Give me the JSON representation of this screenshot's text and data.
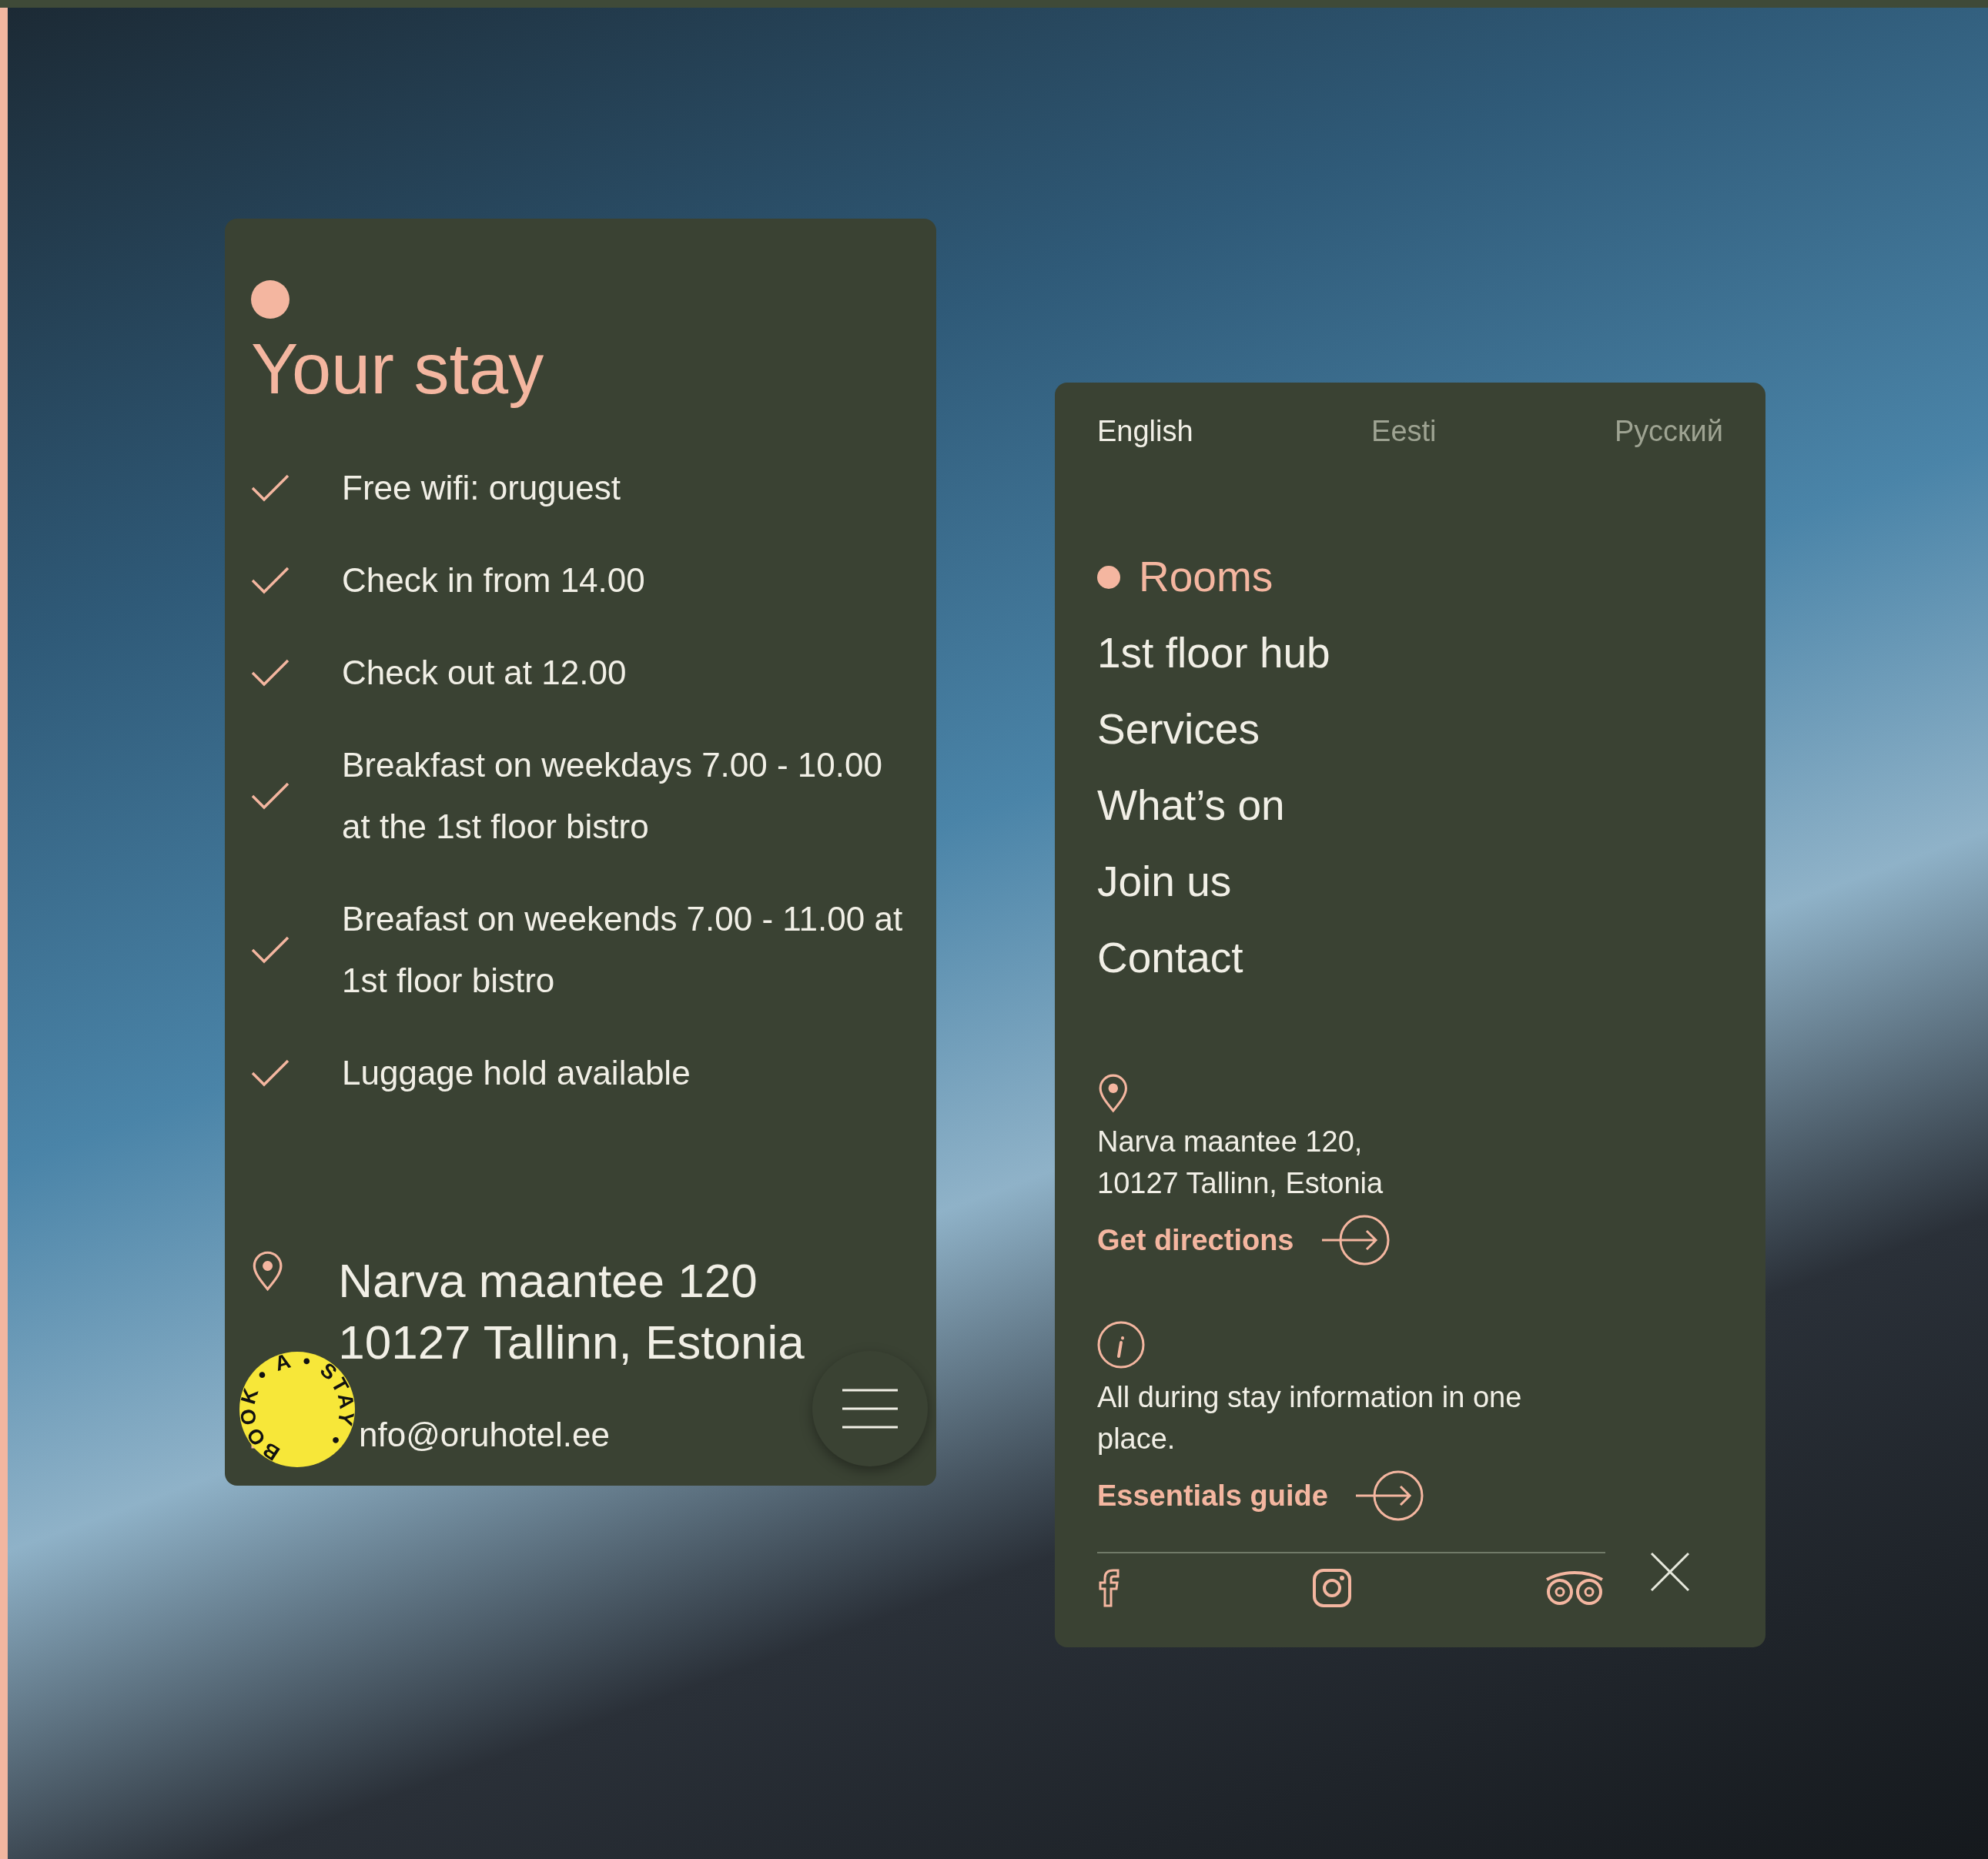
{
  "stay_card": {
    "title": "Your stay",
    "items": [
      "Free wifi: oruguest",
      "Check in from 14.00",
      "Check out at 12.00",
      "Breakfast on weekdays 7.00 - 10.00 at the 1st floor bistro",
      "Breafast on weekends 7.00 - 11.00 at 1st floor bistro",
      "Luggage hold available"
    ],
    "address_lines": [
      "Narva maantee 120",
      "10127 Tallinn, Estonia"
    ],
    "email": "nfo@oruhotel.ee",
    "badge": "BOOK • A • STAY •"
  },
  "menu_panel": {
    "languages": [
      {
        "label": "English",
        "selected": true
      },
      {
        "label": "Eesti",
        "selected": false
      },
      {
        "label": "Русский",
        "selected": false
      }
    ],
    "nav": [
      {
        "label": "Rooms",
        "selected": true
      },
      {
        "label": "1st floor hub",
        "selected": false
      },
      {
        "label": "Services",
        "selected": false
      },
      {
        "label": "What’s on",
        "selected": false
      },
      {
        "label": "Join us",
        "selected": false
      },
      {
        "label": "Contact",
        "selected": false
      }
    ],
    "address_lines": [
      "Narva maantee 120,",
      "10127 Tallinn, Estonia"
    ],
    "directions_link": "Get directions",
    "info_text": "All during stay information in one place.",
    "guide_link": "Essentials guide"
  }
}
